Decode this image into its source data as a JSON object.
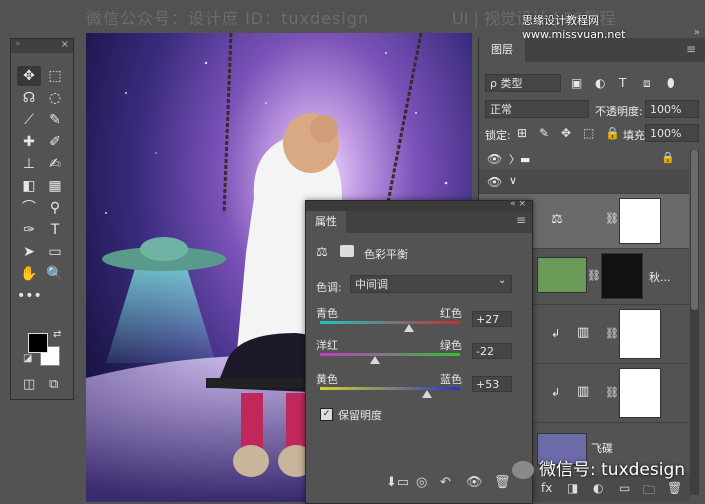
{
  "watermark": {
    "top_left": "微信公众号：设计庶  ID：tuxdesign",
    "top_right": "UI | 视觉设计 | PS教程",
    "site": "思缘设计教程网 www.missyuan.net",
    "bottom_right": "微信号: tuxdesign"
  },
  "tools_panel": {
    "close": "×",
    "grip": "»",
    "tools": [
      "✥",
      "⬚",
      "☊",
      "◌",
      "⟋",
      "✎",
      "✚",
      "✐",
      "⊥",
      "✍",
      "◧",
      "▦",
      "⌒",
      "⚲",
      "✑",
      "T",
      "➤",
      "▭",
      "✋",
      "🔍",
      "•••"
    ],
    "swap": "⇄",
    "reset": "◪",
    "quickmask": "◫",
    "screen": "⧉"
  },
  "layers_panel": {
    "tab_label": "图层",
    "menu": "≡",
    "close": "»",
    "filter_label": "ρ 类型",
    "filter_icons": [
      "▣",
      "◐",
      "T",
      "⧈",
      "⬮"
    ],
    "blend_mode": "正常",
    "opacity_label": "不透明度:",
    "opacity_value": "100%",
    "lock_label": "锁定:",
    "lock_icons": [
      "⊞",
      "✎",
      "✥",
      "⬚",
      "🔒"
    ],
    "fill_label": "填充:",
    "fill_value": "100%",
    "layers": [
      {
        "eye": "👁",
        "name": "",
        "kind": "group-collapsed",
        "lock": "🔒"
      },
      {
        "eye": "👁",
        "name": "",
        "kind": "group-open"
      },
      {
        "eye": "",
        "name": "",
        "kind": "color-balance"
      },
      {
        "eye": "",
        "name": "秋...",
        "kind": "photo-mask"
      },
      {
        "eye": "",
        "name": "",
        "kind": "levels"
      },
      {
        "eye": "",
        "name": "",
        "kind": "levels"
      },
      {
        "eye": "",
        "name": "飞碟",
        "kind": "photo"
      }
    ],
    "bottom_icons": [
      "⊕",
      "fx",
      "◨",
      "◐",
      "▭",
      "🗀",
      "🗑"
    ]
  },
  "properties_panel": {
    "tab_label": "属性",
    "menu": "≡",
    "close": "«  ×",
    "adjustment_name": "色彩平衡",
    "tone_label": "色调:",
    "tone_value": "中间调",
    "sliders": [
      {
        "left": "青色",
        "right": "红色",
        "value": "+27",
        "level": 27,
        "gradient": [
          "#1fc4c4",
          "#c43030"
        ]
      },
      {
        "left": "洋红",
        "right": "绿色",
        "value": "-22",
        "level": -22,
        "gradient": [
          "#c43bc4",
          "#2cc42c"
        ]
      },
      {
        "left": "黄色",
        "right": "蓝色",
        "value": "+53",
        "level": 53,
        "gradient": [
          "#d2d22a",
          "#2a34c8"
        ]
      }
    ],
    "preserve_luminosity": "保留明度",
    "check": "✓",
    "bottom_icons": [
      "⬇▭",
      "◎",
      "↶",
      "👁",
      "🗑"
    ]
  },
  "colors": {
    "ui_bg": "#535353",
    "panel_dark": "#424242",
    "canvas_purple": "#3a2b7e"
  }
}
